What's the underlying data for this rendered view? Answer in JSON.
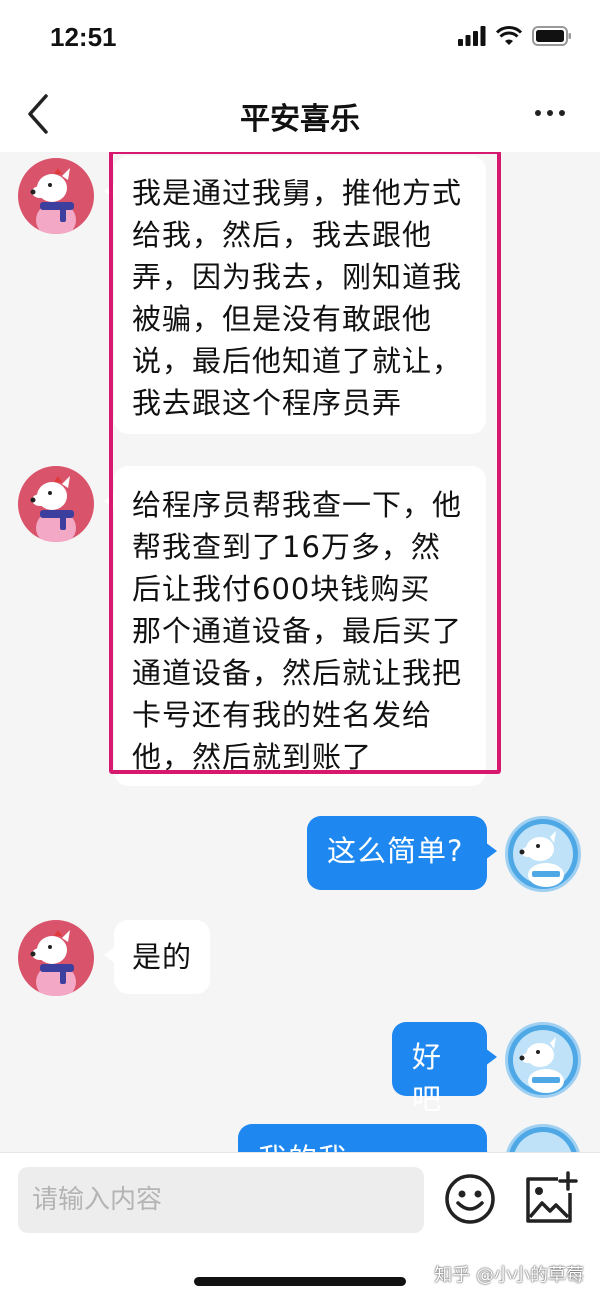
{
  "status": {
    "time": "12:51"
  },
  "header": {
    "title": "平安喜乐",
    "back_icon": "chevron-left-icon",
    "more_icon": "more-dots-icon"
  },
  "messages": [
    {
      "side": "left",
      "text_lines": [
        "我是通过我舅，推他方式",
        "给我，然后，我去跟他",
        "弄，因为我去，刚知道我",
        "被骗，但是没有敢跟他",
        "说，最后他知道了就让，",
        "我去跟这个程序员弄"
      ]
    },
    {
      "side": "left",
      "text_lines": [
        "给程序员帮我查一下，他",
        "帮我查到了16万多，然",
        "后让我付600块钱购买",
        "那个通道设备，最后买了",
        "通道设备，然后就让我把",
        "卡号还有我的姓名发给",
        "他，然后就到账了"
      ]
    },
    {
      "side": "right",
      "text": "这么简单?"
    },
    {
      "side": "left",
      "text": "是的"
    },
    {
      "side": "right",
      "text": "好吧"
    },
    {
      "side": "right",
      "text": "我的我..."
    }
  ],
  "input": {
    "placeholder": "请输入内容"
  },
  "watermark": "知乎 @小小的草莓",
  "colors": {
    "accent": "#1e88f0",
    "highlight": "#d6196f",
    "avatar_pink": "#d9546a",
    "avatar_blue": "#4ea8e6"
  }
}
